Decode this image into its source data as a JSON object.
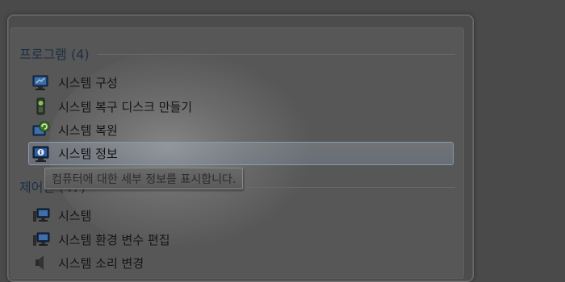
{
  "sections": {
    "programs": {
      "header": "프로그램 (4)",
      "items": [
        {
          "label": "시스템 구성",
          "icon": "system-config-icon"
        },
        {
          "label": "시스템 복구 디스크 만들기",
          "icon": "recovery-disc-icon"
        },
        {
          "label": "시스템 복원",
          "icon": "system-restore-icon"
        },
        {
          "label": "시스템 정보",
          "icon": "system-info-icon",
          "selected": true
        }
      ]
    },
    "control_panel": {
      "header": "제어판 (47)",
      "items": [
        {
          "label": "시스템",
          "icon": "system-monitor-icon"
        },
        {
          "label": "시스템 환경 변수 편집",
          "icon": "system-env-icon"
        },
        {
          "label": "시스템 소리 변경",
          "icon": "speaker-icon"
        }
      ]
    }
  },
  "tooltip": "컴퓨터에 대한 세부 정보를 표시합니다."
}
